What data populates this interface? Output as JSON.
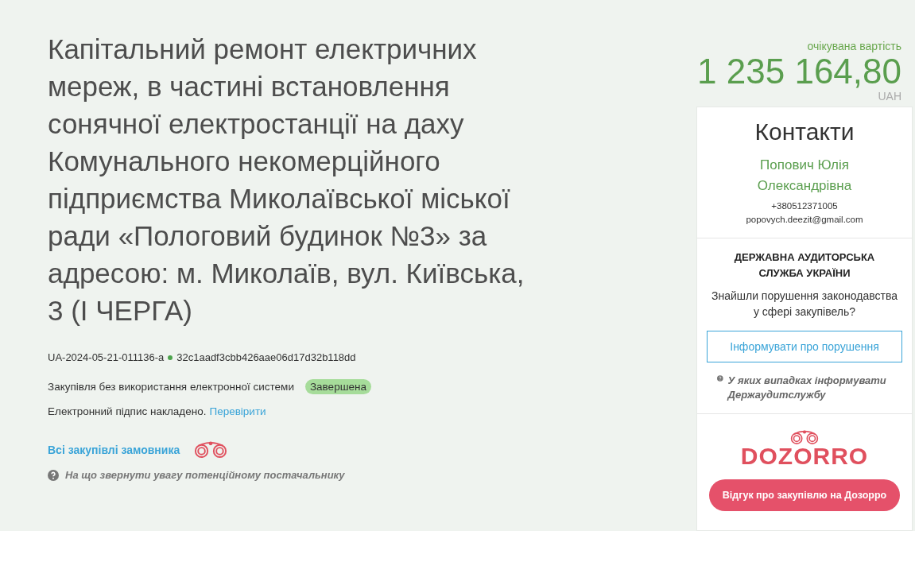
{
  "title": "Капітальний ремонт електричних мереж, в частині встановлення сонячної електростанції на даху Комунального некомерційного підприємства Миколаївської міської ради «Пологовий будинок №3» за адресою: м. Миколаїв, вул. Київська, 3 (І ЧЕРГА)",
  "tender_id": "UA-2024-05-21-011136-a",
  "hash": "32c1aadf3cbb426aae06d17d32b118dd",
  "procurement_type": "Закупівля без використання електронної системи",
  "status": {
    "label": "Завершена",
    "color": "#a6dc9a"
  },
  "signature": {
    "text": "Електронний підпис накладено.",
    "link": "Перевірити"
  },
  "all_purchases_link": "Всі закупівлі замовника",
  "supplier_hint": "На що звернути увагу потенційному постачальнику",
  "price": {
    "label": "очікувана вартість",
    "amount": "1 235 164,80",
    "currency": "UAH"
  },
  "contacts": {
    "title": "Контакти",
    "name": "Попович Юлія Олександрівна",
    "phone": "+380512371005",
    "email": "popovych.deezit@gmail.com"
  },
  "audit": {
    "org": "ДЕРЖАВНА АУДИТОРСЬКА СЛУЖБА УКРАЇНИ",
    "question": "Знайшли порушення законодавства у сфері закупівель?",
    "button": "Інформувати про порушення",
    "hint": "У яких випадках інформувати Держаудитслужбу"
  },
  "dozorro": {
    "logo": "DOZORRO",
    "button": "Відгук про закупівлю на Дозорро"
  }
}
